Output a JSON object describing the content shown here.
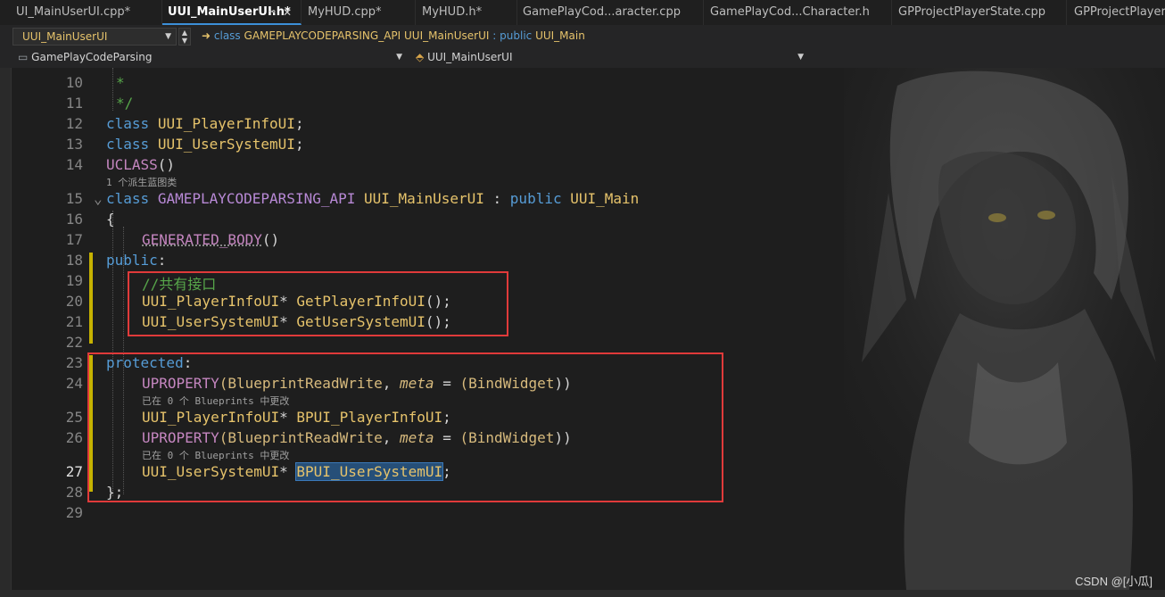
{
  "tabs": [
    {
      "label": "UI_MainUserUI.cpp*",
      "active": false
    },
    {
      "label": "UUI_MainUserUI.h*",
      "active": true
    },
    {
      "label": "MyHUD.cpp*",
      "active": false
    },
    {
      "label": "MyHUD.h*",
      "active": false
    },
    {
      "label": "GamePlayCod...aracter.cpp",
      "active": false
    },
    {
      "label": "GamePlayCod...Character.h",
      "active": false
    },
    {
      "label": "GPProjectPlayerState.cpp",
      "active": false
    },
    {
      "label": "GPProjectPlayerSt",
      "active": false
    }
  ],
  "tab_pin": "⊸",
  "tab_close": "✕",
  "nav": {
    "class_combo": "UUI_MainUserUI",
    "scope_kw": "class",
    "scope_api": "GAMEPLAYCODEPARSING_API",
    "scope_class": "UUI_MainUserUI",
    "scope_sep": ": public",
    "scope_base": "UUI_Main",
    "project_combo": "GamePlayCodeParsing",
    "member_combo": "UUI_MainUserUI"
  },
  "lines": {
    "l10": {
      "num": "10",
      "text": "*"
    },
    "l11": {
      "num": "11",
      "text": "*/"
    },
    "l12": {
      "num": "12",
      "kw": "class",
      "name": "UUI_PlayerInfoUI",
      "end": ";"
    },
    "l13": {
      "num": "13",
      "kw": "class",
      "name": "UUI_UserSystemUI",
      "end": ";"
    },
    "l14": {
      "num": "14",
      "macro": "UCLASS",
      "end": "()"
    },
    "hint14": "1 个派生蓝图类",
    "l15": {
      "num": "15",
      "kw": "class",
      "api": "GAMEPLAYCODEPARSING_API",
      "name": "UUI_MainUserUI",
      "sep": ":",
      "kw2": "public",
      "base": "UUI_Main"
    },
    "l16": {
      "num": "16",
      "text": "{"
    },
    "l17": {
      "num": "17",
      "macro": "GENERATED_BODY",
      "end": "()"
    },
    "l18": {
      "num": "18",
      "kw": "public",
      "end": ":"
    },
    "l19": {
      "num": "19",
      "comment": "//共有接口"
    },
    "l20": {
      "num": "20",
      "type": "UUI_PlayerInfoUI",
      "ptr": "*",
      "fn": "GetPlayerInfoUI",
      "end": "();"
    },
    "l21": {
      "num": "21",
      "type": "UUI_UserSystemUI",
      "ptr": "*",
      "fn": "GetUserSystemUI",
      "end": "();"
    },
    "l22": {
      "num": "22"
    },
    "l23": {
      "num": "23",
      "kw": "protected",
      "end": ":"
    },
    "l24": {
      "num": "24",
      "macro": "UPROPERTY",
      "p1": "(",
      "spec": "BlueprintReadWrite",
      "comma": ",",
      "meta": "meta",
      "eq": "=",
      "p2": "(",
      "bind": "BindWidget",
      "p3": "))"
    },
    "hint24": "已在 0 个 Blueprints 中更改",
    "l25": {
      "num": "25",
      "type": "UUI_PlayerInfoUI",
      "ptr": "*",
      "var": "BPUI_PlayerInfoUI",
      "end": ";"
    },
    "l26": {
      "num": "26",
      "macro": "UPROPERTY",
      "p1": "(",
      "spec": "BlueprintReadWrite",
      "comma": ",",
      "meta": "meta",
      "eq": "=",
      "p2": "(",
      "bind": "BindWidget",
      "p3": "))"
    },
    "hint26": "已在 0 个 Blueprints 中更改",
    "l27": {
      "num": "27",
      "type": "UUI_UserSystemUI",
      "ptr": "*",
      "var": "BPUI_UserSystemUI",
      "end": ";"
    },
    "l28": {
      "num": "28",
      "text": "};"
    },
    "l29": {
      "num": "29"
    }
  },
  "watermark": "CSDN @[小瓜]",
  "colors": {
    "accent": "#3c8fd8",
    "annotation_box": "#e03a3a",
    "change_bar": "#c6b200"
  }
}
